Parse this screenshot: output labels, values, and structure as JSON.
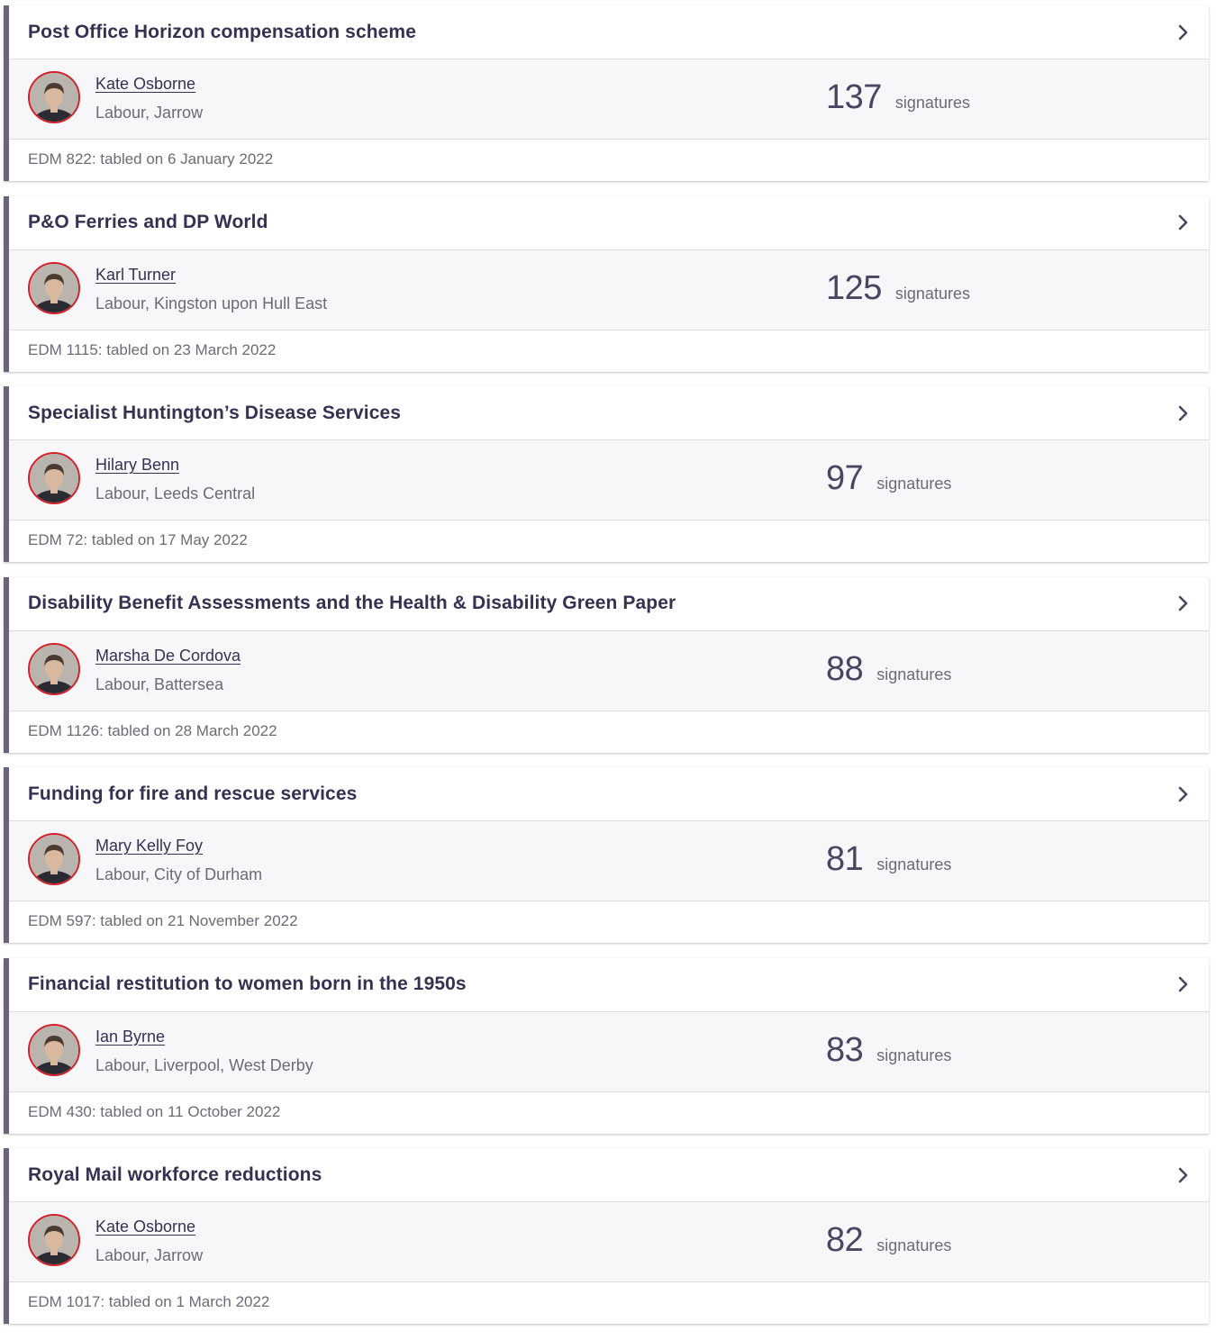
{
  "colors": {
    "accent_bar": "#6c6378",
    "avatar_ring": "#d4202a",
    "body_background": "#f7f7fa"
  },
  "icons": {
    "chevron": "chevron-right-icon"
  },
  "motions": [
    {
      "title": "Post Office Horizon compensation scheme",
      "member_name": "Kate Osborne",
      "member_party": "Labour, Jarrow",
      "signatures": "137",
      "signatures_label": "signatures",
      "footer": "EDM 822: tabled on 6 January 2022"
    },
    {
      "title": "P&O Ferries and DP World",
      "member_name": "Karl Turner",
      "member_party": "Labour, Kingston upon Hull East",
      "signatures": "125",
      "signatures_label": "signatures",
      "footer": "EDM 1115: tabled on 23 March 2022"
    },
    {
      "title": "Specialist Huntington’s Disease Services",
      "member_name": "Hilary Benn",
      "member_party": "Labour, Leeds Central",
      "signatures": "97",
      "signatures_label": "signatures",
      "footer": "EDM 72: tabled on 17 May 2022"
    },
    {
      "title": "Disability Benefit Assessments and the Health & Disability Green Paper",
      "member_name": "Marsha De Cordova",
      "member_party": "Labour, Battersea",
      "signatures": "88",
      "signatures_label": "signatures",
      "footer": "EDM 1126: tabled on 28 March 2022"
    },
    {
      "title": "Funding for fire and rescue services",
      "member_name": "Mary Kelly Foy",
      "member_party": "Labour, City of Durham",
      "signatures": "81",
      "signatures_label": "signatures",
      "footer": "EDM 597: tabled on 21 November 2022"
    },
    {
      "title": "Financial restitution to women born in the 1950s",
      "member_name": "Ian Byrne",
      "member_party": "Labour, Liverpool, West Derby",
      "signatures": "83",
      "signatures_label": "signatures",
      "footer": "EDM 430: tabled on 11 October 2022"
    },
    {
      "title": "Royal Mail workforce reductions",
      "member_name": "Kate Osborne",
      "member_party": "Labour, Jarrow",
      "signatures": "82",
      "signatures_label": "signatures",
      "footer": "EDM 1017: tabled on 1 March 2022"
    }
  ]
}
